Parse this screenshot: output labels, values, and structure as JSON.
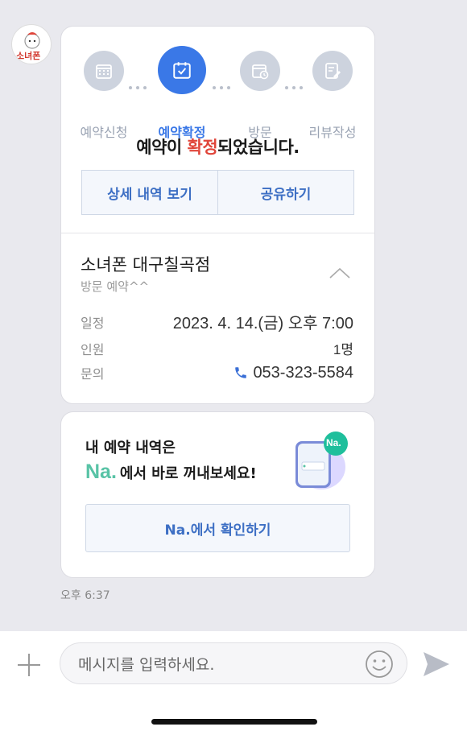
{
  "steps": [
    {
      "label": "예약신청",
      "icon": "calendar-grid-icon"
    },
    {
      "label": "예약확정",
      "icon": "calendar-check-icon",
      "active": true
    },
    {
      "label": "방문",
      "icon": "calendar-clock-icon"
    },
    {
      "label": "리뷰작성",
      "icon": "pencil-note-icon"
    }
  ],
  "headline": {
    "prefix": "예약이 ",
    "highlight": "확정",
    "suffix": "되었습니다."
  },
  "buttons": {
    "details": "상세 내역 보기",
    "share": "공유하기"
  },
  "store": {
    "name": "소녀폰 대구칠곡점",
    "subtitle": "방문 예약^^"
  },
  "info": {
    "schedule_label": "일정",
    "schedule_value": "2023. 4. 14.(금) 오후 7:00",
    "people_label": "인원",
    "people_value": "1명",
    "contact_label": "문의",
    "contact_value": "053-323-5584"
  },
  "promo": {
    "line1": "내 예약 내역은",
    "logo": "Na.",
    "line2": "에서 바로 꺼내보세요!",
    "badge": "Na.",
    "button": "Na.에서 확인하기"
  },
  "avatar_text": "소녀폰",
  "timestamp": "오후 6:37",
  "input": {
    "placeholder": "메시지를 입력하세요."
  },
  "colors": {
    "accent": "#3a78e7",
    "highlight": "#e0453a",
    "na_green": "#58c3a6"
  }
}
